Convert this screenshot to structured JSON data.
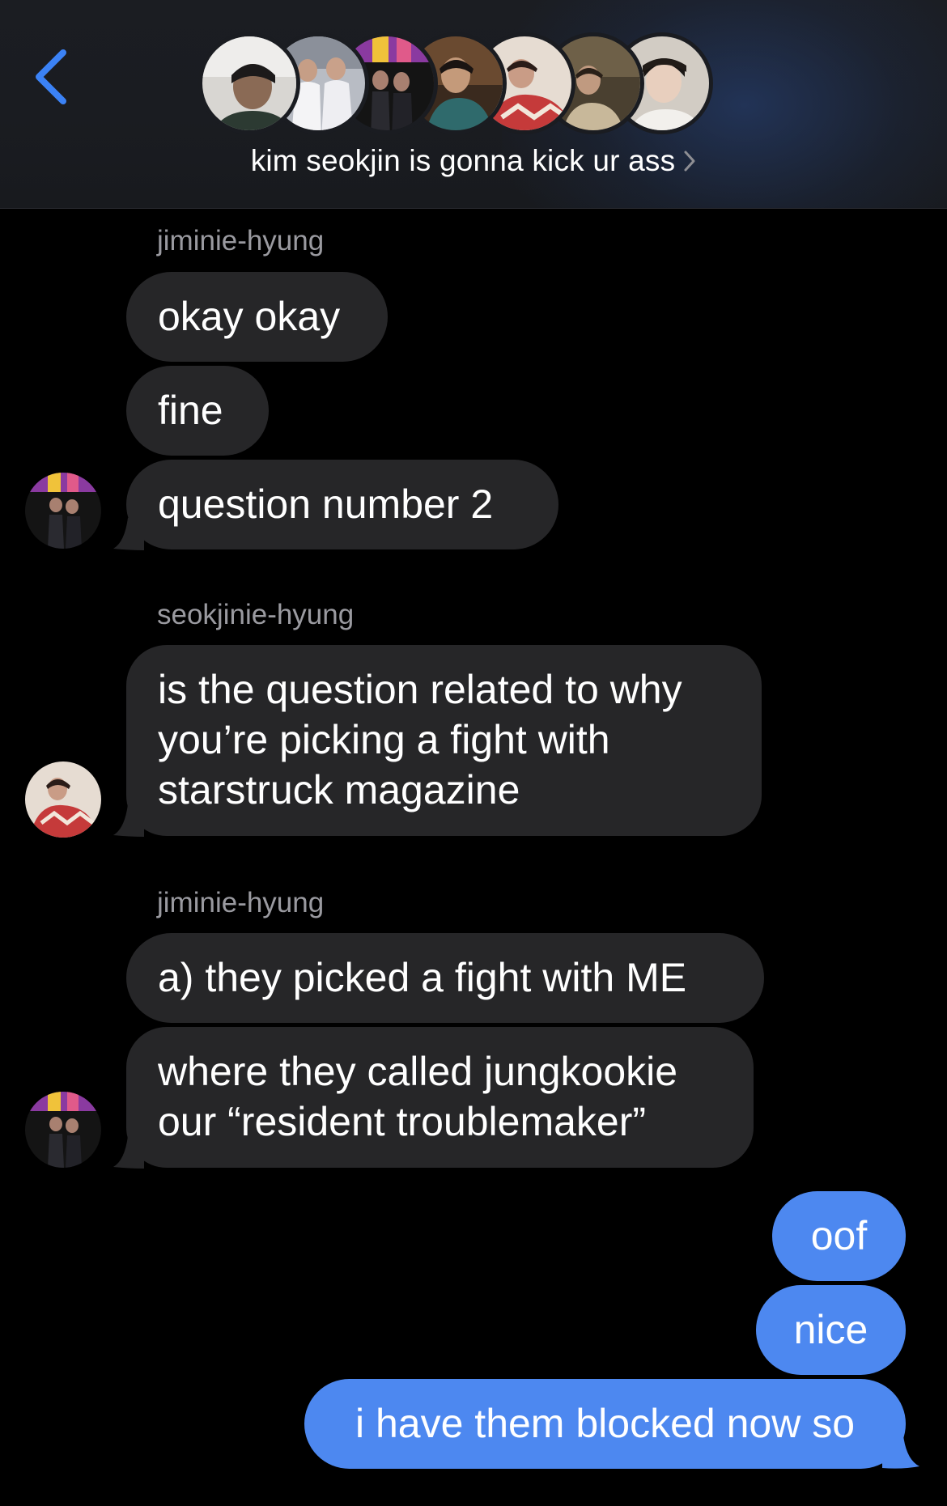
{
  "header": {
    "back_label": "Back",
    "group_name": "kim seokjin is gonna kick ur ass",
    "avatar_count": 7
  },
  "messages": [
    {
      "sender": "jiminie-hyung",
      "bubbles": [
        "okay okay",
        "fine",
        "question number 2"
      ]
    },
    {
      "sender": "seokjinie-hyung",
      "bubbles": [
        "is the question related to why\nyou’re picking a fight with\nstarstruck magazine"
      ]
    },
    {
      "sender": "jiminie-hyung",
      "bubbles": [
        "a) they picked a fight with ME",
        "where they called jungkookie\nour “resident troublemaker”"
      ]
    },
    {
      "sender": "",
      "outgoing": true,
      "bubbles": [
        "oof",
        "nice",
        "i have them blocked now so"
      ]
    }
  ],
  "colors": {
    "incoming_bubble": "#262628",
    "outgoing_bubble": "#4d88f0",
    "accent": "#3b82f6",
    "sender_label": "#9a9aa0"
  },
  "icons": {
    "back": "chevron-left-icon",
    "details": "chevron-right-icon"
  }
}
